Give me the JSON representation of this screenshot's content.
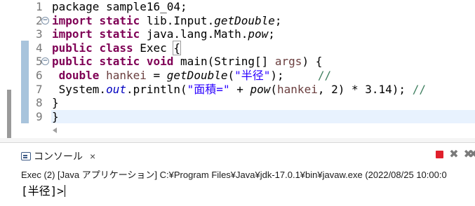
{
  "editor": {
    "line_numbers": [
      "1",
      "2",
      "3",
      "4",
      "5",
      "6",
      "7",
      "8",
      "9"
    ],
    "fold_marker": "−",
    "lines": [
      [
        [
          "plain",
          "package sample16_04;"
        ]
      ],
      [
        [
          "kw",
          "import"
        ],
        [
          "plain",
          " "
        ],
        [
          "kw",
          "static"
        ],
        [
          "plain",
          " lib.Input."
        ],
        [
          "it",
          "getDouble"
        ],
        [
          "plain",
          ";"
        ]
      ],
      [
        [
          "kw",
          "import"
        ],
        [
          "plain",
          " "
        ],
        [
          "kw",
          "static"
        ],
        [
          "plain",
          " java.lang.Math."
        ],
        [
          "it",
          "pow"
        ],
        [
          "plain",
          ";"
        ]
      ],
      [
        [
          "kw",
          "public"
        ],
        [
          "plain",
          " "
        ],
        [
          "kw",
          "class"
        ],
        [
          "plain",
          " Exec "
        ],
        [
          "bracket",
          "{"
        ]
      ],
      [
        [
          "kw",
          "public"
        ],
        [
          "plain",
          " "
        ],
        [
          "kw",
          "static"
        ],
        [
          "plain",
          " "
        ],
        [
          "kw",
          "void"
        ],
        [
          "plain",
          " main(String[] "
        ],
        [
          "var",
          "args"
        ],
        [
          "plain",
          ") {"
        ]
      ],
      [
        [
          "plain",
          " "
        ],
        [
          "kw",
          "double"
        ],
        [
          "plain",
          " "
        ],
        [
          "var",
          "hankei"
        ],
        [
          "plain",
          " = "
        ],
        [
          "it",
          "getDouble"
        ],
        [
          "plain",
          "("
        ],
        [
          "str",
          "\"半径\""
        ],
        [
          "plain",
          ");     "
        ],
        [
          "cm",
          "//"
        ]
      ],
      [
        [
          "plain",
          " System."
        ],
        [
          "field",
          "out"
        ],
        [
          "plain",
          ".println("
        ],
        [
          "str",
          "\"面積=\""
        ],
        [
          "plain",
          " + "
        ],
        [
          "it",
          "pow"
        ],
        [
          "plain",
          "("
        ],
        [
          "var",
          "hankei"
        ],
        [
          "plain",
          ", 2) * 3.14); "
        ],
        [
          "cm",
          "//"
        ]
      ],
      [
        [
          "plain",
          "}"
        ]
      ],
      [
        [
          "plain",
          "}"
        ]
      ]
    ]
  },
  "console": {
    "tab_label": "コンソール",
    "tab_close": "×",
    "status_line": "Exec (2) [Java アプリケーション] C:¥Program Files¥Java¥jdk-17.0.1¥bin¥javaw.exe  (2022/08/25 10:00:0",
    "output_text": "[半径]>",
    "icons": {
      "terminate": "terminate-icon",
      "remove_launch": "remove-launch-icon",
      "remove_all": "remove-all-terminated-icon"
    }
  },
  "colors": {
    "keyword": "#7f0055",
    "string": "#2a00ff",
    "comment": "#3f7f5f",
    "field": "#0000c0",
    "local_var": "#6a3e3e",
    "current_line": "#e8f2fe",
    "change_bar": "#a8c4dc",
    "terminate": "#e0202c"
  }
}
